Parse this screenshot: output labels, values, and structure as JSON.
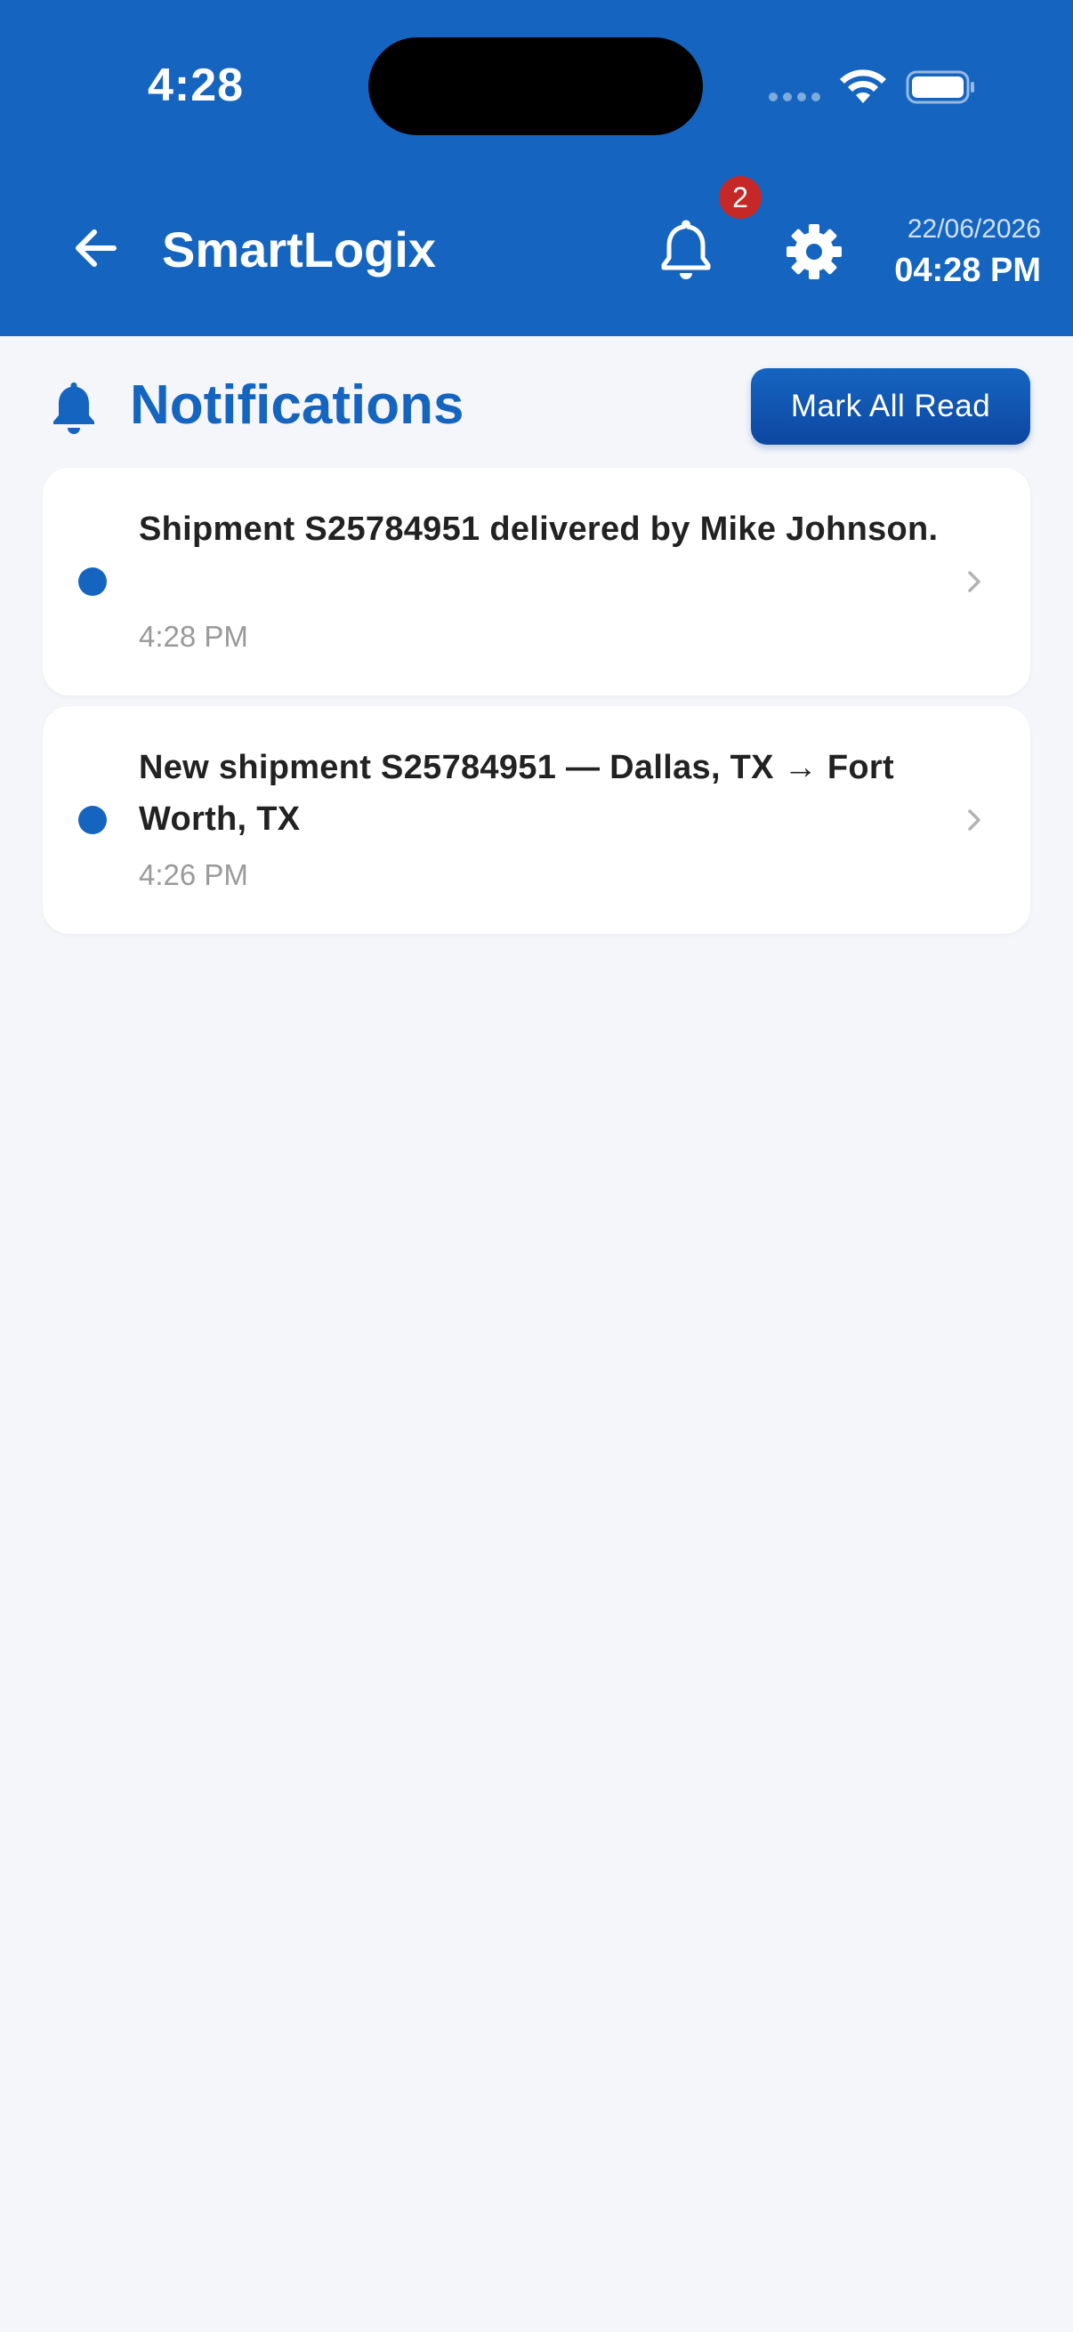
{
  "status_bar": {
    "time": "4:28",
    "icons": [
      "signal-icon",
      "wifi-icon",
      "battery-icon"
    ]
  },
  "app_bar": {
    "title": "SmartLogix",
    "back_icon": "arrow-left-icon",
    "bell_icon": "bell-icon",
    "notification_badge": "2",
    "gear_icon": "gear-icon",
    "date": "22/06/2026",
    "time": "04:28 PM"
  },
  "notifications": {
    "title": "Notifications",
    "title_icon": "bell-icon",
    "mark_all_label": "Mark All Read",
    "items": [
      {
        "message": "Shipment S25784951 delivered by Mike Johnson.",
        "time": "4:28 PM",
        "unread": true
      },
      {
        "message": "New shipment S25784951 — Dallas, TX → Fort Worth, TX",
        "time": "4:26 PM",
        "unread": true
      }
    ]
  },
  "colors": {
    "primary": "#1565c0",
    "badge": "#c62828",
    "background": "#f4f6fa"
  }
}
